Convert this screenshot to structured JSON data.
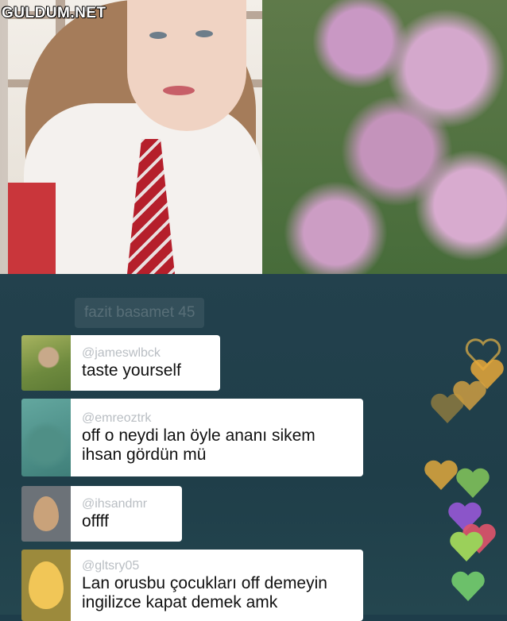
{
  "watermark": "GULDUM.NET",
  "stream": {
    "scene": "live-video-frame"
  },
  "chat": {
    "faded_comment": "fazit basamet 45",
    "comments": [
      {
        "username": "@jameswlbck",
        "text": "taste yourself",
        "avatar": "photo-avatar-green"
      },
      {
        "username": "@emreoztrk",
        "text": "off o neydi lan öyle ananı sikem\nihsan gördün mü",
        "avatar": "photo-avatar-teal"
      },
      {
        "username": "@ihsandmr",
        "text": "offff",
        "avatar": "egg-avatar-gray"
      },
      {
        "username": "@gltsry05",
        "text": "Lan orusbu çocukları off demeyin\ningilizce kapat demek amk",
        "avatar": "egg-avatar-yellow"
      }
    ]
  },
  "hearts": {
    "colors": [
      "#e7b447",
      "#e6a83a",
      "#d9a441",
      "#7ec05a",
      "#8b55c9",
      "#e0546b",
      "#9bd05a",
      "#6cc06a",
      "#f0c64a"
    ],
    "icon": "heart-icon"
  }
}
